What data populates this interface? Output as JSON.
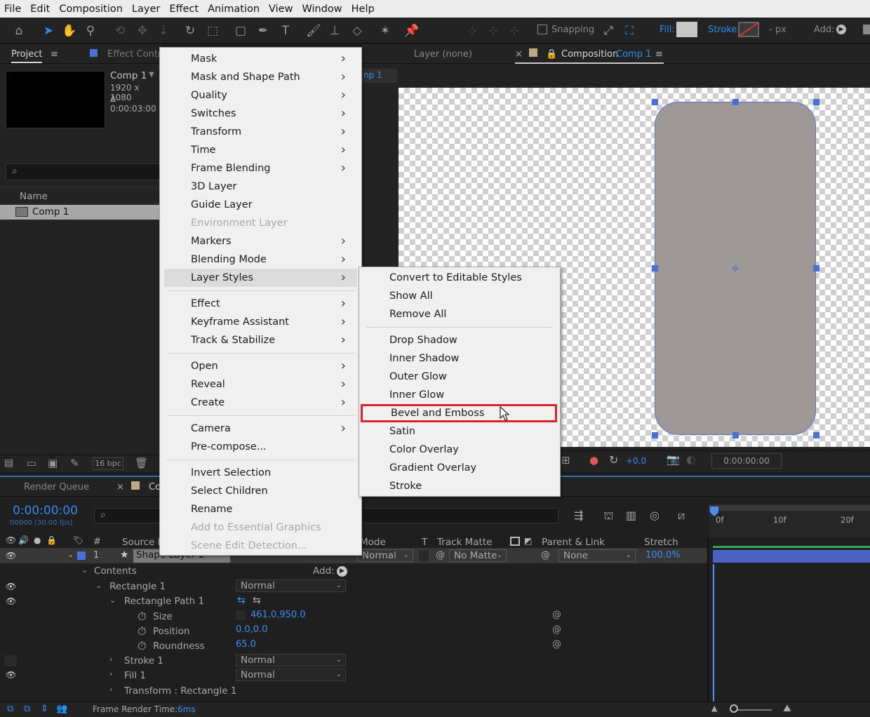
{
  "menubar": [
    "File",
    "Edit",
    "Composition",
    "Layer",
    "Effect",
    "Animation",
    "View",
    "Window",
    "Help"
  ],
  "toolbar": {
    "snapping": "Snapping",
    "fill_label": "Fill:",
    "stroke_label": "Stroke:",
    "stroke_px": "- px",
    "add_label": "Add:"
  },
  "project_panel": {
    "tab_project": "Project",
    "tab_effect": "Effect Contro",
    "comp_name": "Comp 1",
    "comp_dims": "1920 x 1080",
    "comp_duration": "Δ 0:00:03:00",
    "search_glyph": "⌕",
    "col_name": "Name",
    "item_name": "Comp 1",
    "bpc": "16 bpc"
  },
  "viewer": {
    "tab_layer": "Layer (none)",
    "tab_comp": "Composition",
    "tab_comp_name": "Comp 1",
    "sub_tab": "np 1",
    "exposure": "+0.0",
    "timecode": "0:00:00:00"
  },
  "layer_menu": [
    {
      "label": "Mask",
      "sub": true
    },
    {
      "label": "Mask and Shape Path",
      "sub": true
    },
    {
      "label": "Quality",
      "sub": true
    },
    {
      "label": "Switches",
      "sub": true
    },
    {
      "label": "Transform",
      "sub": true
    },
    {
      "label": "Time",
      "sub": true
    },
    {
      "label": "Frame Blending",
      "sub": true
    },
    {
      "label": "3D Layer",
      "sub": false
    },
    {
      "label": "Guide Layer",
      "sub": false
    },
    {
      "label": "Environment Layer",
      "sub": false,
      "disabled": true
    },
    {
      "label": "Markers",
      "sub": true
    },
    {
      "label": "Blending Mode",
      "sub": true
    },
    {
      "label": "Layer Styles",
      "sub": true,
      "highlighted": true
    },
    {
      "label": "Effect",
      "sub": true
    },
    {
      "label": "Keyframe Assistant",
      "sub": true
    },
    {
      "label": "Track & Stabilize",
      "sub": true
    },
    {
      "label": "Open",
      "sub": true
    },
    {
      "label": "Reveal",
      "sub": true
    },
    {
      "label": "Create",
      "sub": true
    },
    {
      "label": "Camera",
      "sub": true
    },
    {
      "label": "Pre-compose...",
      "sub": false
    },
    {
      "label": "Invert Selection",
      "sub": false
    },
    {
      "label": "Select Children",
      "sub": false
    },
    {
      "label": "Rename",
      "sub": false
    },
    {
      "label": "Add to Essential Graphics",
      "sub": false,
      "disabled": true
    },
    {
      "label": "Scene Edit Detection...",
      "sub": false,
      "disabled": true
    }
  ],
  "styles_menu": [
    {
      "label": "Convert to Editable Styles"
    },
    {
      "label": "Show All"
    },
    {
      "label": "Remove All"
    },
    {
      "label": "Drop Shadow"
    },
    {
      "label": "Inner Shadow"
    },
    {
      "label": "Outer Glow"
    },
    {
      "label": "Inner Glow"
    },
    {
      "label": "Bevel and Emboss",
      "boxed": true
    },
    {
      "label": "Satin"
    },
    {
      "label": "Color Overlay"
    },
    {
      "label": "Gradient Overlay"
    },
    {
      "label": "Stroke"
    }
  ],
  "timeline": {
    "tab_render": "Render Queue",
    "tab_comp": "Co",
    "timecode": "0:00:00:00",
    "frames": "00000 (30.00 fps)",
    "col_hash": "#",
    "col_source": "Source N",
    "col_mode": "Mode",
    "col_t": "T",
    "col_trackmatte": "Track Matte",
    "col_parent": "Parent & Link",
    "col_stretch": "Stretch",
    "ruler": [
      "0f",
      "10f",
      "20f"
    ],
    "layer_num": "1",
    "layer_name": "Shape Layer 1",
    "layer_mode": "Normal",
    "layer_matte": "No Matte",
    "layer_parent": "None",
    "layer_stretch": "100.0%",
    "contents": "Contents",
    "add": "Add:",
    "rect": "Rectangle 1",
    "rect_mode": "Normal",
    "rect_path": "Rectangle Path 1",
    "size_label": "Size",
    "size_val": "461.0,950.0",
    "pos_label": "Position",
    "pos_val": "0.0,0.0",
    "round_label": "Roundness",
    "round_val": "65.0",
    "stroke": "Stroke 1",
    "stroke_mode": "Normal",
    "fill": "Fill 1",
    "fill_mode": "Normal",
    "transform": "Transform : Rectangle 1",
    "render_time_label": "Frame Render Time:",
    "render_time_val": "6ms"
  }
}
